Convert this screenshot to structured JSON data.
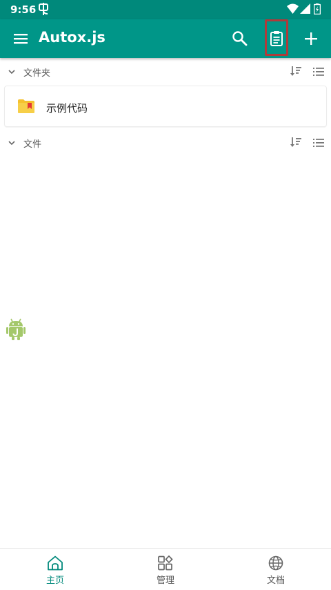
{
  "status_bar": {
    "time": "9:56",
    "icons": [
      "notification-icon",
      "wifi-icon",
      "signal-icon",
      "battery-icon"
    ]
  },
  "app_bar": {
    "title": "Autox.js",
    "icons": [
      "menu-icon",
      "search-icon",
      "log-icon",
      "add-icon"
    ]
  },
  "sections": {
    "folders": {
      "label": "文件夹"
    },
    "files": {
      "label": "文件"
    }
  },
  "folders": [
    {
      "name": "示例代码"
    }
  ],
  "bottom_nav": {
    "items": [
      {
        "label": "主页",
        "icon": "home-icon",
        "active": true
      },
      {
        "label": "管理",
        "icon": "grid-icon",
        "active": false
      },
      {
        "label": "文档",
        "icon": "globe-icon",
        "active": false
      }
    ]
  },
  "colors": {
    "primary": "#009688",
    "status_bar": "#00897b",
    "highlight_border": "#b03a3a",
    "folder": "#f5c12e",
    "folder_tag": "#e53935",
    "float_icon": "#a4c86a"
  }
}
